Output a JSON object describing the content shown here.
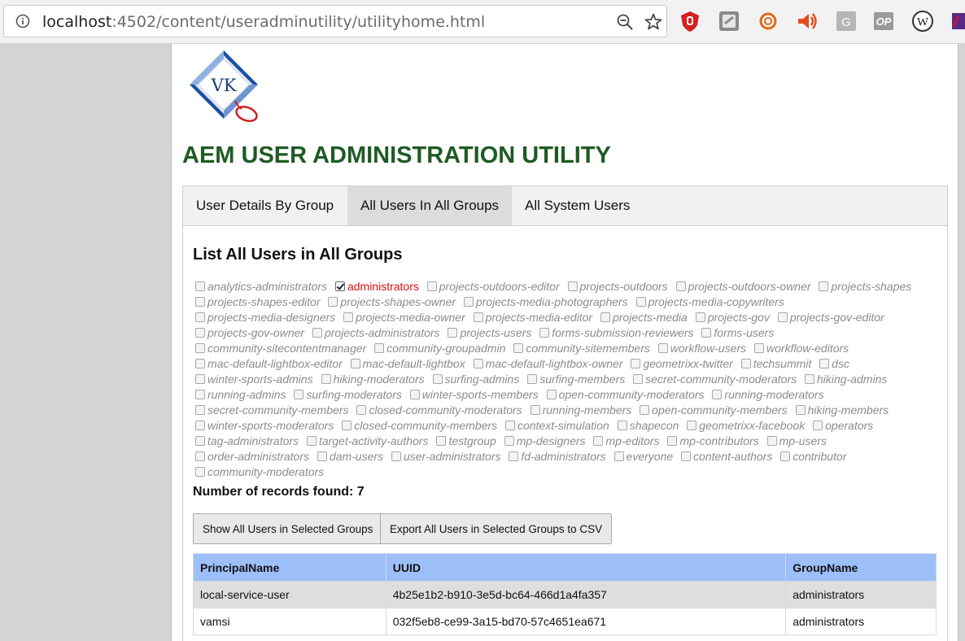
{
  "browser": {
    "url_host": "localhost",
    "url_path": ":4502/content/useradminutility/utilityhome.html",
    "extensions": [
      "ublock-icon",
      "notes-icon",
      "cookie-icon",
      "audio-icon",
      "g-icon",
      "op-icon",
      "wappalyzer-icon",
      "extension-icon"
    ]
  },
  "app": {
    "logo_text": "VK",
    "title": "AEM USER ADMINISTRATION UTILITY"
  },
  "tabs": [
    {
      "label": "User Details By Group",
      "active": false
    },
    {
      "label": "All Users In All Groups",
      "active": true
    },
    {
      "label": "All System Users",
      "active": false
    }
  ],
  "section": {
    "title": "List All Users in All Groups"
  },
  "groups": [
    {
      "name": "analytics-administrators",
      "checked": false
    },
    {
      "name": "administrators",
      "checked": true
    },
    {
      "name": "projects-outdoors-editor",
      "checked": false
    },
    {
      "name": "projects-outdoors",
      "checked": false
    },
    {
      "name": "projects-outdoors-owner",
      "checked": false
    },
    {
      "name": "projects-shapes",
      "checked": false
    },
    {
      "name": "projects-shapes-editor",
      "checked": false
    },
    {
      "name": "projects-shapes-owner",
      "checked": false
    },
    {
      "name": "projects-media-photographers",
      "checked": false
    },
    {
      "name": "projects-media-copywriters",
      "checked": false
    },
    {
      "name": "projects-media-designers",
      "checked": false
    },
    {
      "name": "projects-media-owner",
      "checked": false
    },
    {
      "name": "projects-media-editor",
      "checked": false
    },
    {
      "name": "projects-media",
      "checked": false
    },
    {
      "name": "projects-gov",
      "checked": false
    },
    {
      "name": "projects-gov-editor",
      "checked": false
    },
    {
      "name": "projects-gov-owner",
      "checked": false
    },
    {
      "name": "projects-administrators",
      "checked": false
    },
    {
      "name": "projects-users",
      "checked": false
    },
    {
      "name": "forms-submission-reviewers",
      "checked": false
    },
    {
      "name": "forms-users",
      "checked": false
    },
    {
      "name": "community-sitecontentmanager",
      "checked": false
    },
    {
      "name": "community-groupadmin",
      "checked": false
    },
    {
      "name": "community-sitemembers",
      "checked": false
    },
    {
      "name": "workflow-users",
      "checked": false
    },
    {
      "name": "workflow-editors",
      "checked": false
    },
    {
      "name": "mac-default-lightbox-editor",
      "checked": false
    },
    {
      "name": "mac-default-lightbox",
      "checked": false
    },
    {
      "name": "mac-default-lightbox-owner",
      "checked": false
    },
    {
      "name": "geometrixx-twitter",
      "checked": false
    },
    {
      "name": "techsummit",
      "checked": false
    },
    {
      "name": "dsc",
      "checked": false
    },
    {
      "name": "winter-sports-admins",
      "checked": false
    },
    {
      "name": "hiking-moderators",
      "checked": false
    },
    {
      "name": "surfing-admins",
      "checked": false
    },
    {
      "name": "surfing-members",
      "checked": false
    },
    {
      "name": "secret-community-moderators",
      "checked": false
    },
    {
      "name": "hiking-admins",
      "checked": false
    },
    {
      "name": "running-admins",
      "checked": false
    },
    {
      "name": "surfing-moderators",
      "checked": false
    },
    {
      "name": "winter-sports-members",
      "checked": false
    },
    {
      "name": "open-community-moderators",
      "checked": false
    },
    {
      "name": "running-moderators",
      "checked": false
    },
    {
      "name": "secret-community-members",
      "checked": false
    },
    {
      "name": "closed-community-moderators",
      "checked": false
    },
    {
      "name": "running-members",
      "checked": false
    },
    {
      "name": "open-community-members",
      "checked": false
    },
    {
      "name": "hiking-members",
      "checked": false
    },
    {
      "name": "winter-sports-moderators",
      "checked": false
    },
    {
      "name": "closed-community-members",
      "checked": false
    },
    {
      "name": "context-simulation",
      "checked": false
    },
    {
      "name": "shapecon",
      "checked": false
    },
    {
      "name": "geometrixx-facebook",
      "checked": false
    },
    {
      "name": "operators",
      "checked": false
    },
    {
      "name": "tag-administrators",
      "checked": false
    },
    {
      "name": "target-activity-authors",
      "checked": false
    },
    {
      "name": "testgroup",
      "checked": false
    },
    {
      "name": "mp-designers",
      "checked": false
    },
    {
      "name": "mp-editors",
      "checked": false
    },
    {
      "name": "mp-contributors",
      "checked": false
    },
    {
      "name": "mp-users",
      "checked": false
    },
    {
      "name": "order-administrators",
      "checked": false
    },
    {
      "name": "dam-users",
      "checked": false
    },
    {
      "name": "user-administrators",
      "checked": false
    },
    {
      "name": "fd-administrators",
      "checked": false
    },
    {
      "name": "everyone",
      "checked": false
    },
    {
      "name": "content-authors",
      "checked": false
    },
    {
      "name": "contributor",
      "checked": false
    },
    {
      "name": "community-moderators",
      "checked": false
    }
  ],
  "records": {
    "label": "Number of records found: 7"
  },
  "buttons": {
    "show_label": "Show All Users in Selected Groups",
    "export_label": "Export All Users in Selected Groups to CSV"
  },
  "table": {
    "headers": [
      "PrincipalName",
      "UUID",
      "GroupName"
    ],
    "rows": [
      [
        "local-service-user",
        "4b25e1b2-b910-3e5d-bc64-466d1a4fa357",
        "administrators"
      ],
      [
        "vamsi",
        "032f5eb8-ce99-3a15-bd70-57c4651ea671",
        "administrators"
      ]
    ]
  }
}
